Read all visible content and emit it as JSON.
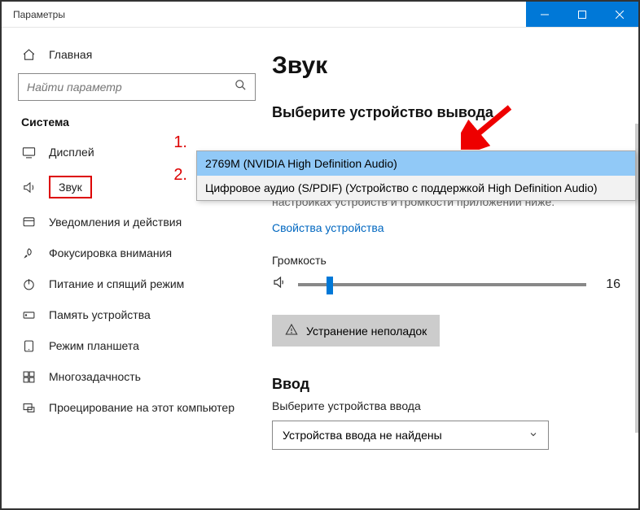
{
  "titlebar": {
    "title": "Параметры"
  },
  "sidebar": {
    "home": "Главная",
    "search_placeholder": "Найти параметр",
    "category": "Система",
    "items": [
      {
        "label": "Дисплей"
      },
      {
        "label": "Звук"
      },
      {
        "label": "Уведомления и действия"
      },
      {
        "label": "Фокусировка внимания"
      },
      {
        "label": "Питание и спящий режим"
      },
      {
        "label": "Память устройства"
      },
      {
        "label": "Режим планшета"
      },
      {
        "label": "Многозадачность"
      },
      {
        "label": "Проецирование на этот компьютер"
      }
    ]
  },
  "main": {
    "heading": "Звук",
    "output_section": "Выберите устройство вывода",
    "dropdown": {
      "opt1": "2769M (NVIDIA High Definition Audio)",
      "opt2": "Цифровое аудио (S/PDIF) (Устройство с поддержкой High Definition Audio)"
    },
    "desc": "параметры вывода. Вы можете персонализировать их в настройках устройств и громкости приложений ниже.",
    "device_props": "Свойства устройства",
    "volume_label": "Громкость",
    "volume_value": "16",
    "troubleshoot": "Устранение неполадок",
    "input_heading": "Ввод",
    "input_section": "Выберите устройства ввода",
    "input_select": "Устройства ввода не найдены"
  },
  "annotations": {
    "n1": "1.",
    "n2": "2."
  }
}
